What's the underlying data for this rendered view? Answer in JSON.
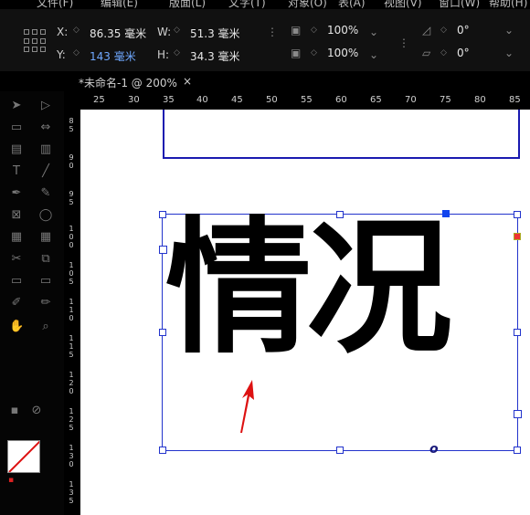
{
  "menubar": {
    "items": [
      "文件(F)",
      "编辑(E)",
      "版面(L)",
      "文字(T)",
      "对象(O)",
      "表(A)",
      "视图(V)",
      "窗口(W)",
      "帮助(H)"
    ]
  },
  "control": {
    "x": {
      "label": "X:",
      "value": "86.35 毫米"
    },
    "y": {
      "label": "Y:",
      "value": "143 毫米"
    },
    "w": {
      "label": "W:",
      "value": "51.3 毫米"
    },
    "h": {
      "label": "H:",
      "value": "34.3 毫米"
    },
    "scale_x": "100%",
    "scale_y": "100%",
    "rotate": "0°",
    "shear": "0°"
  },
  "tab": {
    "title": "*未命名-1 @ 200%",
    "close": "×"
  },
  "ruler": {
    "h_ticks": [
      "25",
      "30",
      "35",
      "40",
      "45",
      "50",
      "55",
      "60",
      "65",
      "70",
      "75",
      "80",
      "85"
    ],
    "v_ticks": [
      "85",
      "90",
      "95",
      "100",
      "105",
      "110",
      "115",
      "120",
      "125",
      "130",
      "135"
    ]
  },
  "document": {
    "text": "情况"
  }
}
